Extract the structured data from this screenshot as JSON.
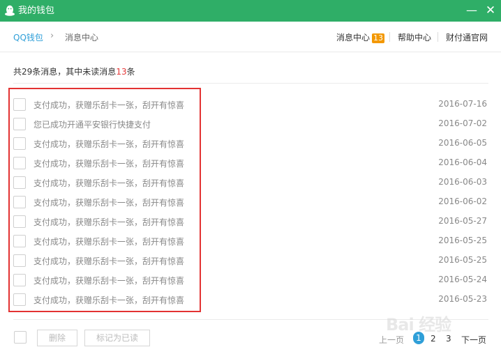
{
  "window": {
    "title": "我的钱包",
    "minimize_label": "—",
    "close_label": "✕"
  },
  "breadcrumb": {
    "home": "QQ钱包",
    "separator": "›",
    "current": "消息中心"
  },
  "topnav": {
    "messages_label": "消息中心",
    "messages_badge": "13",
    "help_label": "帮助中心",
    "official_site_label": "财付通官网"
  },
  "summary": {
    "prefix": "共",
    "total": "29",
    "middle": "条消息，其中未读消息",
    "unread": "13",
    "suffix": "条"
  },
  "messages": [
    {
      "text": "支付成功，获赠乐刮卡一张，刮开有惊喜",
      "date": "2016-07-16"
    },
    {
      "text": "您已成功开通平安银行快捷支付",
      "date": "2016-07-02"
    },
    {
      "text": "支付成功，获赠乐刮卡一张，刮开有惊喜",
      "date": "2016-06-05"
    },
    {
      "text": "支付成功，获赠乐刮卡一张，刮开有惊喜",
      "date": "2016-06-04"
    },
    {
      "text": "支付成功，获赠乐刮卡一张，刮开有惊喜",
      "date": "2016-06-03"
    },
    {
      "text": "支付成功，获赠乐刮卡一张，刮开有惊喜",
      "date": "2016-06-02"
    },
    {
      "text": "支付成功，获赠乐刮卡一张，刮开有惊喜",
      "date": "2016-05-27"
    },
    {
      "text": "支付成功，获赠乐刮卡一张，刮开有惊喜",
      "date": "2016-05-25"
    },
    {
      "text": "支付成功，获赠乐刮卡一张，刮开有惊喜",
      "date": "2016-05-25"
    },
    {
      "text": "支付成功，获赠乐刮卡一张，刮开有惊喜",
      "date": "2016-05-24"
    },
    {
      "text": "支付成功，获赠乐刮卡一张，刮开有惊喜",
      "date": "2016-05-23"
    }
  ],
  "footer": {
    "delete_label": "删除",
    "mark_read_label": "标记为已读"
  },
  "pagination": {
    "prev_label": "上一页",
    "pages": [
      "1",
      "2",
      "3"
    ],
    "current_page": "1",
    "next_label": "下一页"
  },
  "watermark": {
    "text": "Bai 经验"
  },
  "colors": {
    "titlebar": "#2fae67",
    "link": "#2f9fd8",
    "badge": "#f39800",
    "unread_count": "#e53838",
    "highlight_box": "#e33232"
  },
  "icons": {
    "app_logo": "qq-penguin-icon",
    "breadcrumb_separator": "chevron-right-icon"
  }
}
